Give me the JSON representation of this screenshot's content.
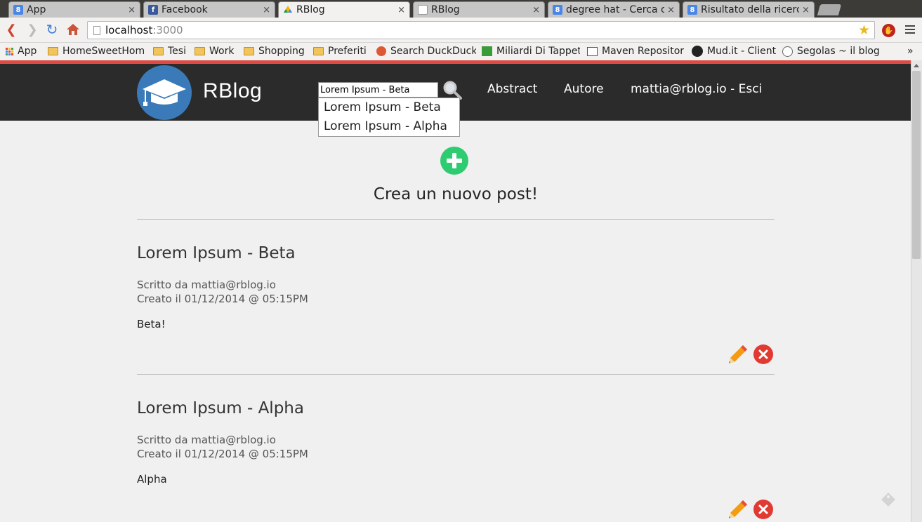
{
  "browser": {
    "tabs": [
      {
        "title": "App",
        "icon": "google-icon"
      },
      {
        "title": "Facebook",
        "icon": "facebook-icon"
      },
      {
        "title": "RBlog",
        "icon": "drive-icon",
        "active": true
      },
      {
        "title": "RBlog",
        "icon": "page-icon"
      },
      {
        "title": "degree hat - Cerca co",
        "icon": "google-icon"
      },
      {
        "title": "Risultato della ricerc",
        "icon": "google-icon"
      }
    ],
    "close_glyph": "×",
    "address": {
      "host": "localhost",
      "port": ":3000"
    },
    "bookmarks": [
      {
        "label": "App",
        "icon": "apps-grid-icon"
      },
      {
        "label": "HomeSweetHom",
        "icon": "folder-icon"
      },
      {
        "label": "Tesi",
        "icon": "folder-icon"
      },
      {
        "label": "Work",
        "icon": "folder-icon"
      },
      {
        "label": "Shopping",
        "icon": "folder-icon"
      },
      {
        "label": "Preferiti",
        "icon": "folder-icon"
      },
      {
        "label": "Search DuckDuck",
        "icon": "duckduckgo-icon"
      },
      {
        "label": "Miliardi Di Tappet",
        "icon": "ln-icon"
      },
      {
        "label": "Maven Repositor",
        "icon": "mvn-icon"
      },
      {
        "label": "Mud.it - Client",
        "icon": "mud-icon"
      },
      {
        "label": "Segolas ~ il blog a",
        "icon": "wordpress-icon"
      }
    ],
    "overflow_glyph": "»"
  },
  "site": {
    "brand": "RBlog",
    "search": {
      "value": "Lorem Ipsum - Beta",
      "suggestions": [
        "Lorem Ipsum - Beta",
        "Lorem Ipsum - Alpha"
      ]
    },
    "nav": {
      "abstract": "Abstract",
      "author": "Autore",
      "user_logout": "mattia@rblog.io - Esci"
    },
    "create_post_label": "Crea un nuovo post!",
    "posts": [
      {
        "title": "Lorem Ipsum - Beta",
        "author_line": "Scritto da mattia@rblog.io",
        "created_line": "Creato il 01/12/2014 @ 05:15PM",
        "body": "Beta!"
      },
      {
        "title": "Lorem Ipsum - Alpha",
        "author_line": "Scritto da mattia@rblog.io",
        "created_line": "Creato il 01/12/2014 @ 05:15PM",
        "body": "Alpha"
      }
    ]
  },
  "colors": {
    "header_bg": "#2b2b2b",
    "accent_red": "#e04a44",
    "logo_blue": "#3b7ab8",
    "add_green": "#2ecc71",
    "delete_red": "#e03b33"
  }
}
